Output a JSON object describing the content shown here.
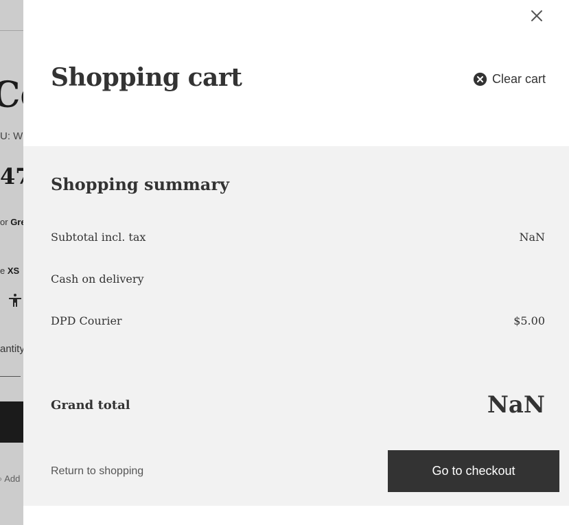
{
  "background_page": {
    "heading_partial": "Ce",
    "sku_partial": "U: WI",
    "price_partial": "47",
    "color_label_partial": "or",
    "color_value_partial": "Gre",
    "size_label_partial": "e",
    "size_value": "XS",
    "quantity_label_partial": "antity",
    "add_link_partial": "Add"
  },
  "cart": {
    "title": "Shopping cart",
    "clear_cart_label": "Clear cart",
    "close_icon": "close-icon",
    "summary": {
      "title": "Shopping summary",
      "subtotal_label": "Subtotal incl. tax",
      "subtotal_value": "NaN",
      "payment_label": "Cash on delivery",
      "payment_value": "",
      "shipping_label": "DPD Courier",
      "shipping_value": "$5.00",
      "grand_total_label": "Grand total",
      "grand_total_value": "NaN"
    },
    "return_link": "Return to shopping",
    "checkout_button": "Go to checkout"
  },
  "colors": {
    "summary_bg": "#f2f2f2",
    "button_bg": "#333333",
    "text": "#333333"
  }
}
